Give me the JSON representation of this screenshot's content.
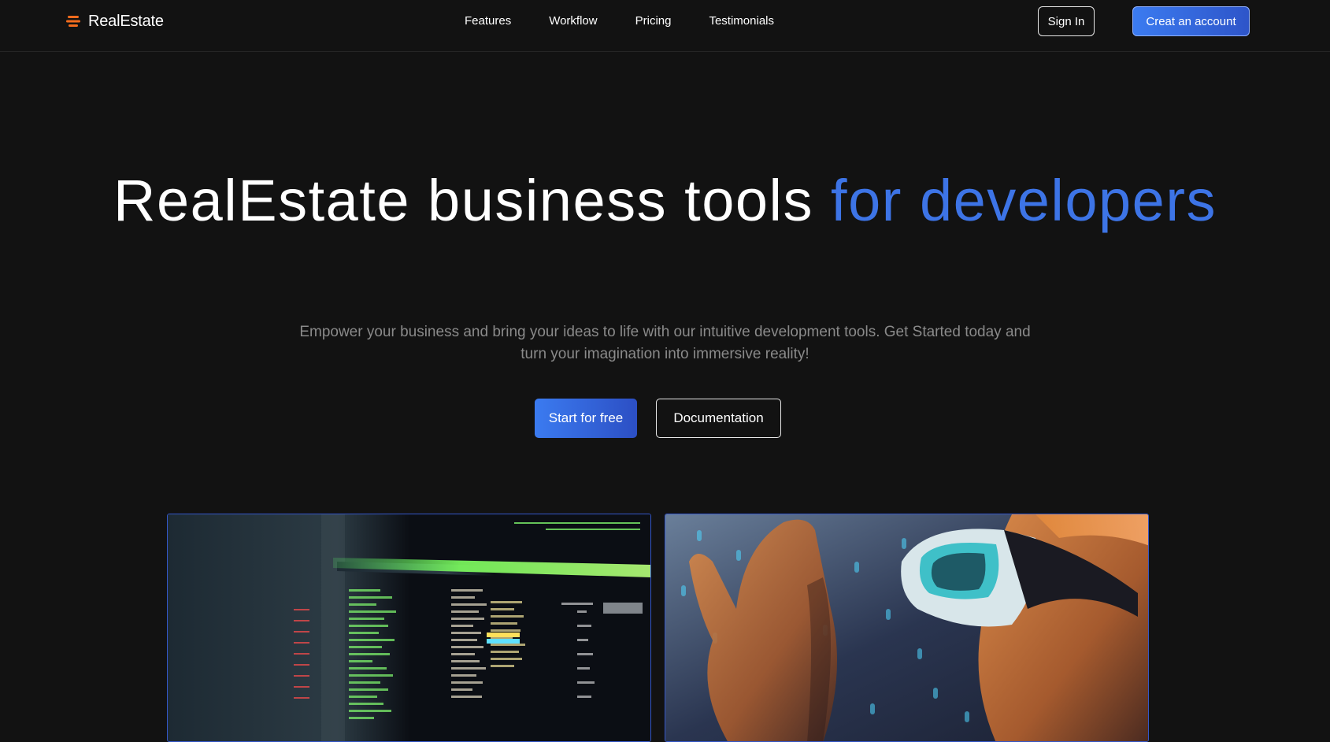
{
  "navbar": {
    "brand": {
      "icon": "stacked-layers-icon",
      "name": "RealEstate",
      "icon_color": "#f26b1d"
    },
    "links": [
      {
        "label": "Features"
      },
      {
        "label": "Workflow"
      },
      {
        "label": "Pricing"
      },
      {
        "label": "Testimonials"
      }
    ],
    "sign_in_label": "Sign In",
    "create_account_label": "Creat an account"
  },
  "hero": {
    "title_main": "RealEstate business tools ",
    "title_accent": "for developers",
    "subtitle": "Empower your business and bring your ideas to life with our intuitive development tools. Get Started today and turn your imagination into immersive reality!",
    "primary_cta_label": "Start for free",
    "secondary_cta_label": "Documentation"
  },
  "media": [
    {
      "subject": "terminal-monitor-photo"
    },
    {
      "subject": "vr-headset-person-photo"
    }
  ],
  "colors": {
    "background": "#121212",
    "accent_blue": "#3d74e6",
    "brand_orange": "#f26b1d",
    "subtitle_gray": "#8a8a8a"
  }
}
